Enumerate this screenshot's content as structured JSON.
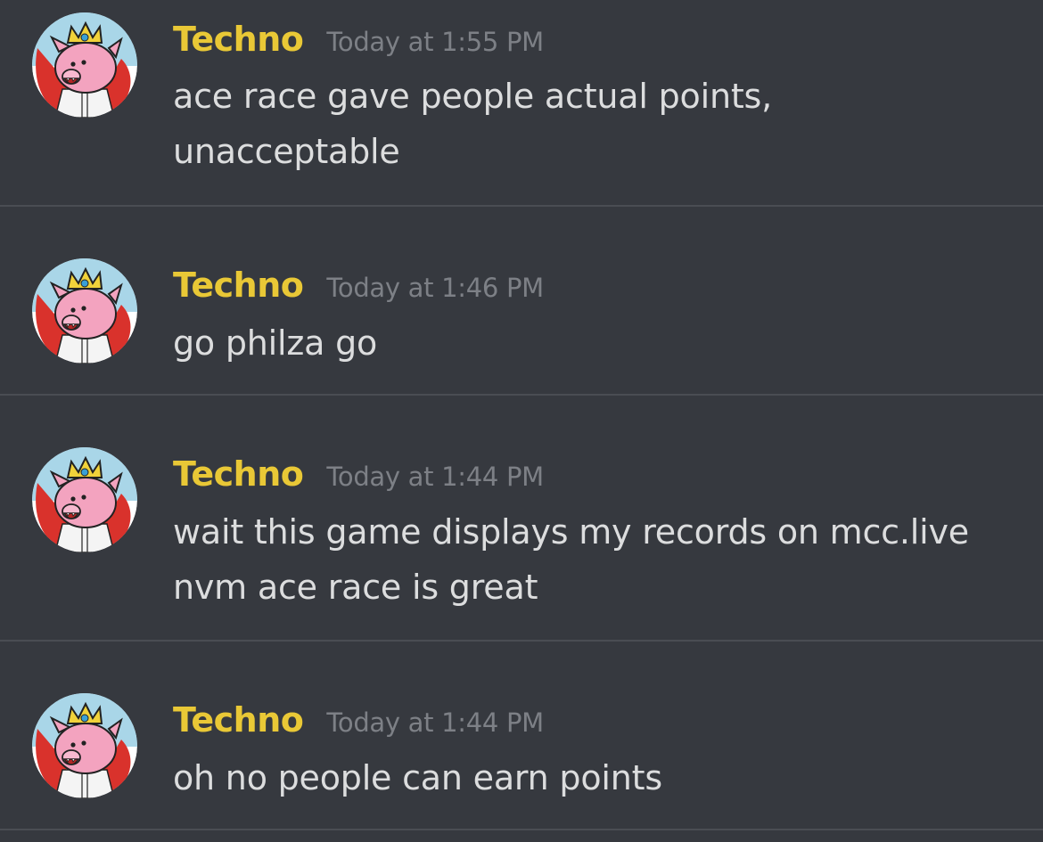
{
  "colors": {
    "background": "#36393f",
    "username": "#e9c836",
    "timestamp": "#7d8086",
    "text": "#dcddde",
    "divider": "#4a4d53"
  },
  "messages": [
    {
      "author": "Techno",
      "timestamp": "Today at 1:55 PM",
      "avatar": "pig-with-crown-avatar",
      "lines": [
        "ace race gave people actual points,",
        "unacceptable"
      ]
    },
    {
      "author": "Techno",
      "timestamp": "Today at 1:46 PM",
      "avatar": "pig-with-crown-avatar",
      "lines": [
        "go philza go"
      ]
    },
    {
      "author": "Techno",
      "timestamp": "Today at 1:44 PM",
      "avatar": "pig-with-crown-avatar",
      "lines": [
        "wait this game displays my records on mcc.live",
        "nvm ace race is great"
      ]
    },
    {
      "author": "Techno",
      "timestamp": "Today at 1:44 PM",
      "avatar": "pig-with-crown-avatar",
      "lines": [
        "oh no people can earn points"
      ]
    }
  ]
}
